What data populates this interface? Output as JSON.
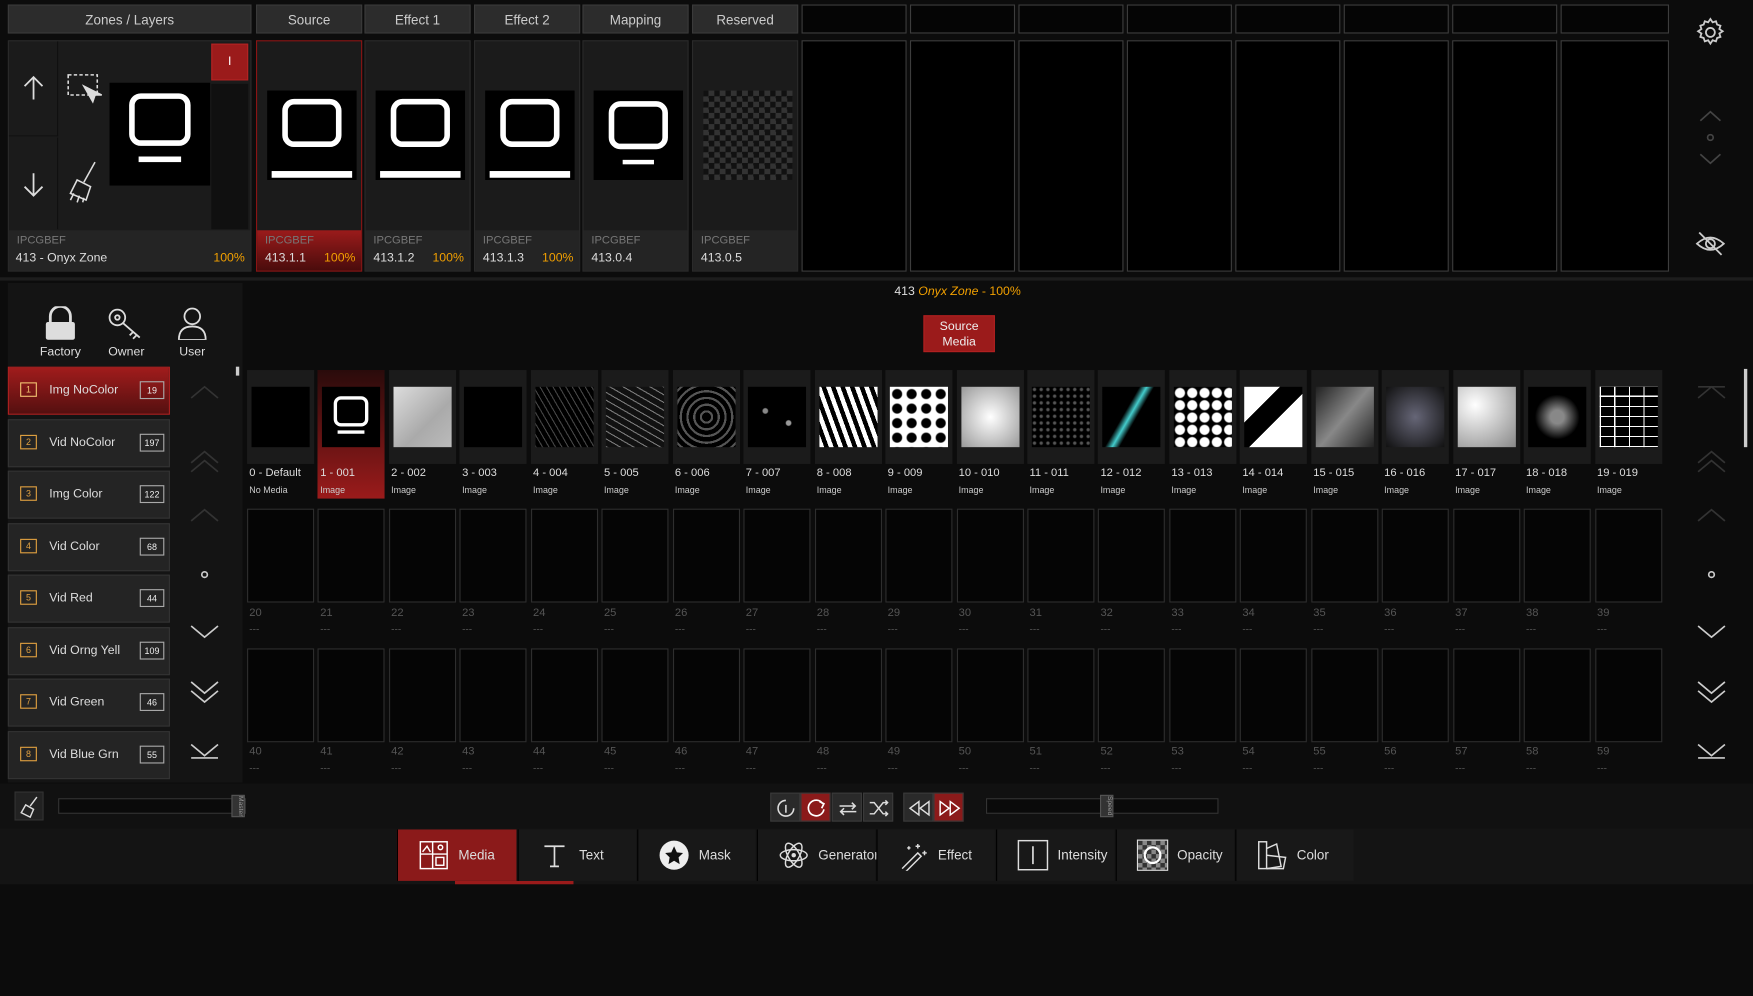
{
  "headers": {
    "zones_layers": "Zones / Layers",
    "source": "Source",
    "effect1": "Effect 1",
    "effect2": "Effect 2",
    "mapping": "Mapping",
    "reserved": "Reserved"
  },
  "zone": {
    "code": "IPCGBEF",
    "name": "413 - Onyx Zone",
    "percent": "100%",
    "indicator": "I"
  },
  "layers": [
    {
      "code": "IPCGBEF",
      "num": "413.1.1",
      "pct": "100%"
    },
    {
      "code": "IPCGBEF",
      "num": "413.1.2",
      "pct": "100%"
    },
    {
      "code": "IPCGBEF",
      "num": "413.1.3",
      "pct": "100%"
    },
    {
      "code": "IPCGBEF",
      "num": "413.0.4",
      "pct": ""
    },
    {
      "code": "IPCGBEF",
      "num": "413.0.5",
      "pct": ""
    }
  ],
  "status": {
    "num": "413",
    "zone": "Onyx Zone",
    "sep": "-",
    "pct": "100%"
  },
  "source_media_button": [
    "Source",
    "Media"
  ],
  "library": {
    "factory": "Factory",
    "owner": "Owner",
    "user": "User"
  },
  "folders": [
    {
      "idx": "1",
      "name": "Img NoColor",
      "count": "19"
    },
    {
      "idx": "2",
      "name": "Vid NoColor",
      "count": "197"
    },
    {
      "idx": "3",
      "name": "Img Color",
      "count": "122"
    },
    {
      "idx": "4",
      "name": "Vid Color",
      "count": "68"
    },
    {
      "idx": "5",
      "name": "Vid Red",
      "count": "44"
    },
    {
      "idx": "6",
      "name": "Vid Orng Yell",
      "count": "109"
    },
    {
      "idx": "7",
      "name": "Vid Green",
      "count": "46"
    },
    {
      "idx": "8",
      "name": "Vid Blue Grn",
      "count": "55"
    }
  ],
  "media": [
    {
      "label": "0 - Default",
      "type": "No Media"
    },
    {
      "label": "1 - 001",
      "type": "Image"
    },
    {
      "label": "2 - 002",
      "type": "Image"
    },
    {
      "label": "3 - 003",
      "type": "Image"
    },
    {
      "label": "4 - 004",
      "type": "Image"
    },
    {
      "label": "5 - 005",
      "type": "Image"
    },
    {
      "label": "6 - 006",
      "type": "Image"
    },
    {
      "label": "7 - 007",
      "type": "Image"
    },
    {
      "label": "8 - 008",
      "type": "Image"
    },
    {
      "label": "9 - 009",
      "type": "Image"
    },
    {
      "label": "10 - 010",
      "type": "Image"
    },
    {
      "label": "11 - 011",
      "type": "Image"
    },
    {
      "label": "12 - 012",
      "type": "Image"
    },
    {
      "label": "13 - 013",
      "type": "Image"
    },
    {
      "label": "14 - 014",
      "type": "Image"
    },
    {
      "label": "15 - 015",
      "type": "Image"
    },
    {
      "label": "16 - 016",
      "type": "Image"
    },
    {
      "label": "17 - 017",
      "type": "Image"
    },
    {
      "label": "18 - 018",
      "type": "Image"
    },
    {
      "label": "19 - 019",
      "type": "Image"
    }
  ],
  "empty_slots_row2": [
    "20",
    "21",
    "22",
    "23",
    "24",
    "25",
    "26",
    "27",
    "28",
    "29",
    "30",
    "31",
    "32",
    "33",
    "34",
    "35",
    "36",
    "37",
    "38",
    "39"
  ],
  "empty_slots_row3": [
    "40",
    "41",
    "42",
    "43",
    "44",
    "45",
    "46",
    "47",
    "48",
    "49",
    "50",
    "51",
    "52",
    "53",
    "54",
    "55",
    "56",
    "57",
    "58",
    "59"
  ],
  "empty_slot_text": "---",
  "sliders": {
    "master": "Master",
    "speed": "Speed"
  },
  "tabs": [
    {
      "label": "Media",
      "icon": "media-icon"
    },
    {
      "label": "Text",
      "icon": "text-icon"
    },
    {
      "label": "Mask",
      "icon": "star-icon"
    },
    {
      "label": "Generator",
      "icon": "atom-icon"
    },
    {
      "label": "Effect",
      "icon": "magic-wand-icon"
    },
    {
      "label": "Intensity",
      "icon": "intensity-icon"
    },
    {
      "label": "Opacity",
      "icon": "checker-icon"
    },
    {
      "label": "Color",
      "icon": "palette-icon"
    }
  ],
  "colors": {
    "accent": "#8b1a1a",
    "percent": "#f2a000",
    "folder_index": "#e0a040"
  }
}
